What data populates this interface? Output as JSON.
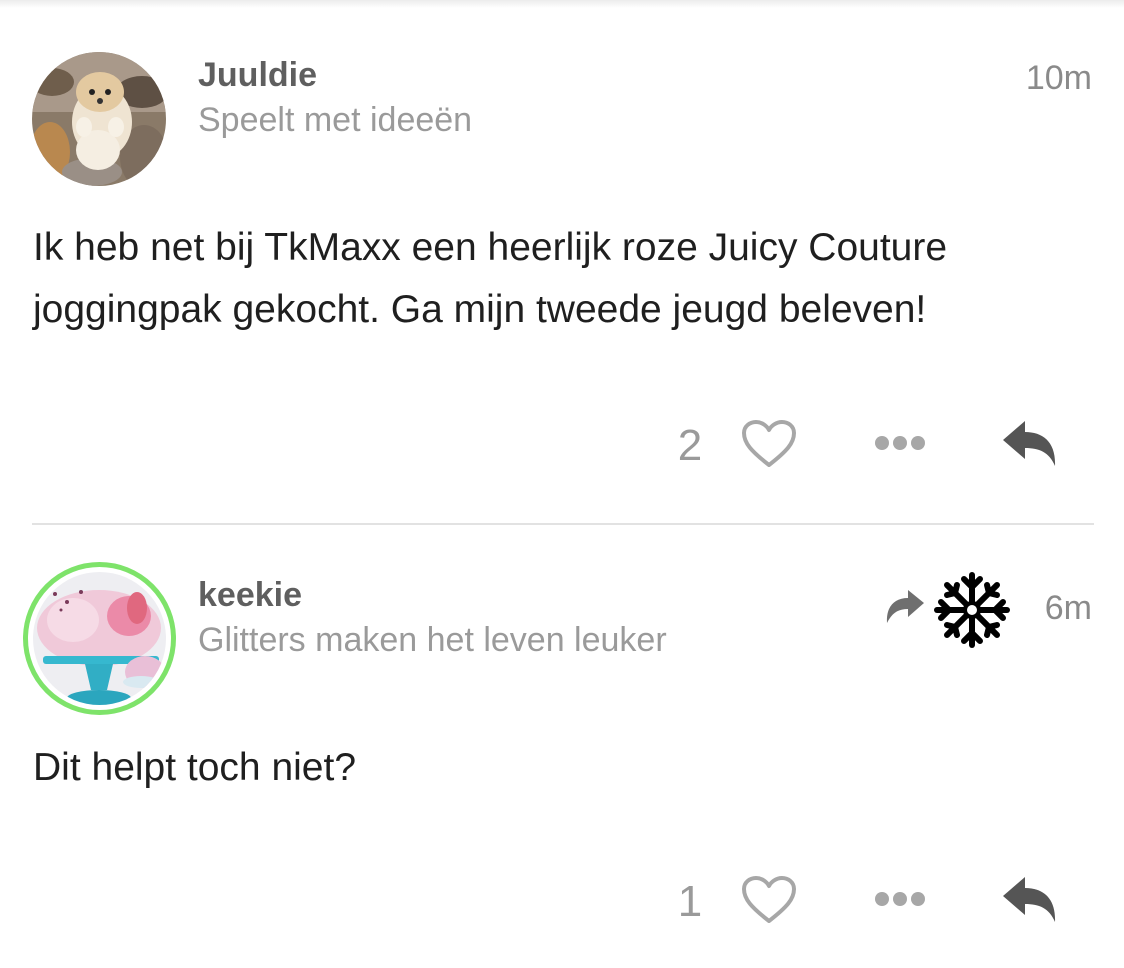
{
  "posts": [
    {
      "username": "Juuldie",
      "tagline": "Speelt met ideeën",
      "timestamp": "10m",
      "body": "Ik heb net bij TkMaxx een heerlijk roze Juicy Couture joggingpak gekocht. Ga mijn tweede jeugd beleven!",
      "like_count": "2",
      "avatar": "pomeranian-puppy-photo"
    },
    {
      "username": "keekie",
      "tagline": "Glitters maken het leven leuker",
      "timestamp": "6m",
      "body": "Dit helpt toch niet?",
      "like_count": "1",
      "avatar": "pink-cake-on-turquoise-stand-photo",
      "avatar_ring_color": "#7ee36a",
      "status_icons": [
        "repost-arrow-icon",
        "snowflake-icon"
      ]
    }
  ],
  "icons": {
    "like": "heart-outline-icon",
    "more": "ellipsis-icon",
    "reply": "reply-arrow-icon"
  },
  "colors": {
    "username": "#5f5f5f",
    "secondary_text": "#9a9a9a",
    "icon_gray": "#a7a7a7",
    "reply_icon": "#555555",
    "divider": "#e2e2e2"
  }
}
